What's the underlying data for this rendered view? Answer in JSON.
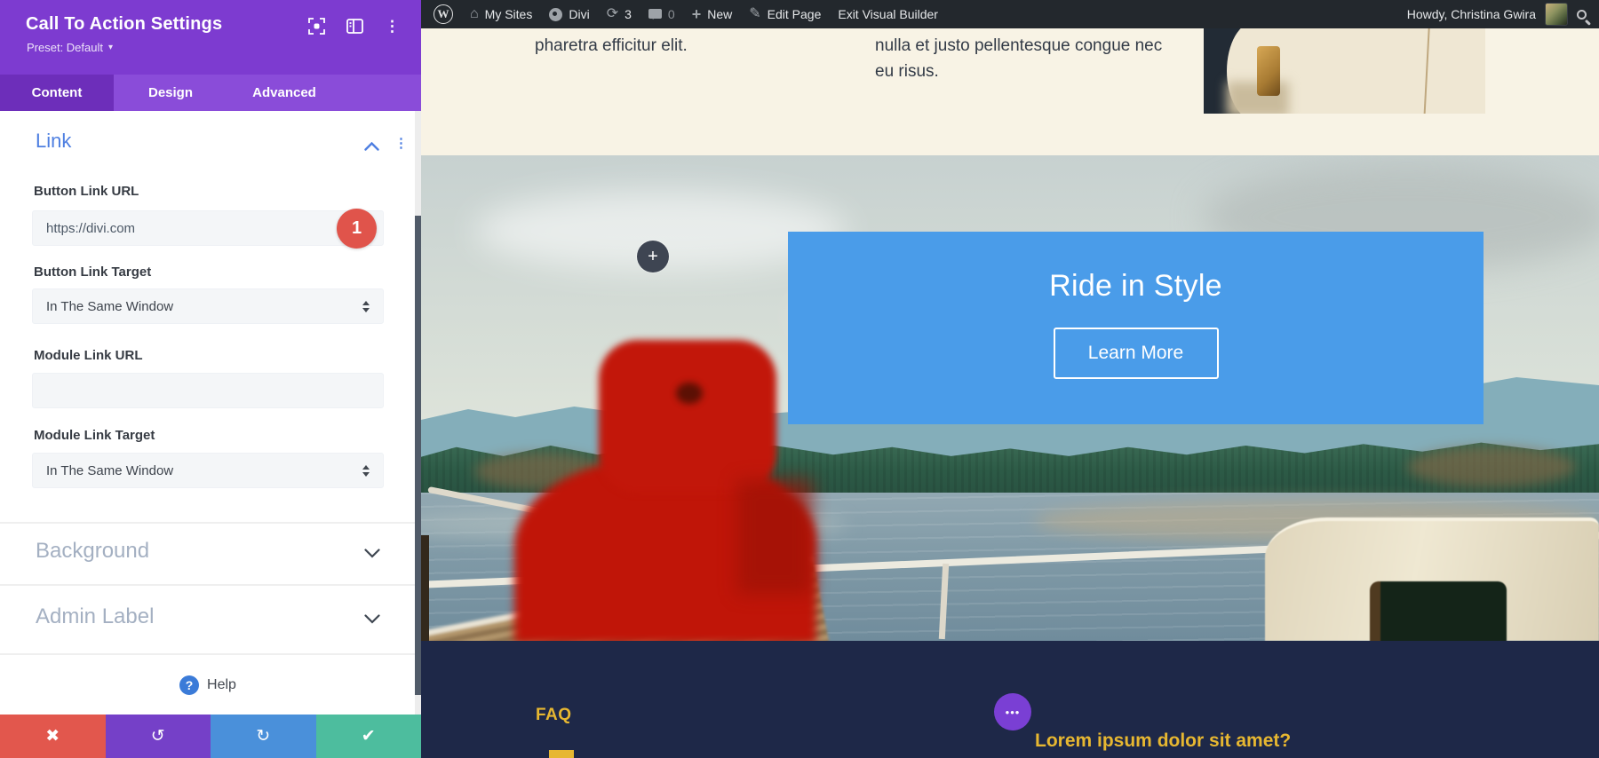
{
  "colors": {
    "panel_purple": "#7d3bd0",
    "tab_bar_purple": "#8a4cd9",
    "active_tab_purple": "#6d2eba",
    "link_blue": "#4e7fe1",
    "badge_red": "#e0544b",
    "action_red": "#e2574d",
    "action_purple": "#7540c8",
    "action_blue": "#4a90da",
    "action_green": "#4dbd9e",
    "admin_bar_bg": "#23282d",
    "cream_bg": "#f8f3e5",
    "cta_blue": "#4a9ce9",
    "faq_navy": "#1e2848",
    "accent_yellow": "#e7b731",
    "dot_circle_purple": "#7a3fd4"
  },
  "panel": {
    "title": "Call To Action Settings",
    "preset": "Preset: Default",
    "tabs": [
      {
        "label": "Content"
      },
      {
        "label": "Design"
      },
      {
        "label": "Advanced"
      }
    ],
    "section_heading": "Link",
    "fields": [
      {
        "label": "Button Link URL",
        "value": "https://divi.com",
        "badge": "1"
      },
      {
        "label": "Button Link Target",
        "value": "In The Same Window"
      },
      {
        "label": "Module Link URL",
        "value": ""
      },
      {
        "label": "Module Link Target",
        "value": "In The Same Window"
      }
    ],
    "collapsed": [
      {
        "label": "Background"
      },
      {
        "label": "Admin Label"
      }
    ],
    "help_label": "Help"
  },
  "admin_bar": {
    "my_sites": "My Sites",
    "divi": "Divi",
    "updates_count": "3",
    "comments_count": "0",
    "new_label": "New",
    "edit_page": "Edit Page",
    "exit_builder": "Exit Visual Builder",
    "howdy": "Howdy, Christina Gwira"
  },
  "preview": {
    "intro_col1": "pharetra efficitur elit.",
    "intro_col2": "nulla et justo pellentesque congue nec eu risus.",
    "cta_heading": "Ride in Style",
    "cta_button": "Learn More",
    "faq_label": "FAQ",
    "faq_question": "Lorem ipsum dolor sit amet?"
  },
  "icons": {
    "kebab": "⋮",
    "plus": "+",
    "close": "✖",
    "undo": "↺",
    "redo": "↻",
    "check": "✔",
    "pencil": "✎",
    "house": "⌂",
    "refresh": "⟳",
    "help_q": "?",
    "dots3": "•••",
    "preset_caret": "▾",
    "wp_logo": "W"
  }
}
